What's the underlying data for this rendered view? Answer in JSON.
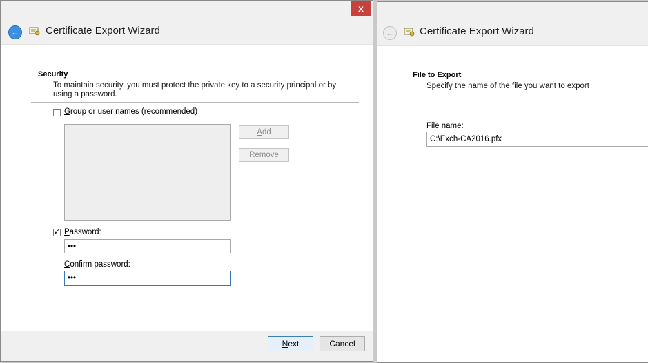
{
  "left_window": {
    "title": "Certificate Export Wizard",
    "close_glyph": "x",
    "section_title": "Security",
    "section_desc": "To maintain security, you must protect the private key to a security principal or by using a password.",
    "group_checkbox_label": "Group or user names (recommended)",
    "group_checked": false,
    "add_label": "Add",
    "remove_label": "Remove",
    "password_checkbox_label": "Password:",
    "password_checked": true,
    "password_value": "•••",
    "confirm_label": "Confirm password:",
    "confirm_value": "•••",
    "next_label": "Next",
    "cancel_label": "Cancel"
  },
  "right_window": {
    "title": "Certificate Export Wizard",
    "section_title": "File to Export",
    "section_desc": "Specify the name of the file you want to export",
    "file_name_label": "File name:",
    "file_name_value": "C:\\Exch-CA2016.pfx"
  }
}
